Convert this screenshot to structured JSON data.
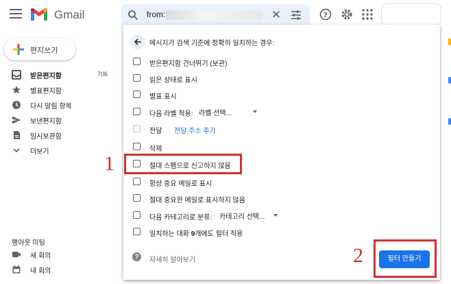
{
  "app": {
    "brand": "Gmail",
    "search": {
      "query": "from:("
    },
    "accent_color": "#1a73e8",
    "annotation_color": "#d32f2f"
  },
  "sidebar": {
    "compose_label": "편지쓰기",
    "items": [
      {
        "label": "받은편지함",
        "count": "706",
        "icon": "inbox-icon",
        "bold": true
      },
      {
        "label": "별표편지함",
        "icon": "star-icon"
      },
      {
        "label": "다시 알림 항목",
        "icon": "clock-icon"
      },
      {
        "label": "보낸편지함",
        "icon": "send-icon"
      },
      {
        "label": "임시보관함",
        "icon": "file-icon"
      },
      {
        "label": "더보기",
        "icon": "chevron-down-icon"
      }
    ],
    "meet": {
      "title": "행아웃 미팅",
      "items": [
        {
          "label": "새 회의",
          "icon": "video-icon"
        },
        {
          "label": "내 회의",
          "icon": "calendar-icon"
        }
      ]
    }
  },
  "filter_panel": {
    "header": "메시지가 검색 기준에 정확히 일치하는 경우:",
    "options": [
      {
        "label": "받은편지함 건너뛰기 (보관)"
      },
      {
        "label": "읽은 상태로 표시"
      },
      {
        "label": "별표 표시"
      },
      {
        "label": "다음 라벨 적용:",
        "select": "라벨 선택..."
      },
      {
        "label": "전달",
        "link": "전달 주소 추가",
        "disabled": true
      },
      {
        "label": "삭제"
      },
      {
        "label": "절대 스팸으로 신고하지 않음"
      },
      {
        "label": "항상 중요 메일로 표시"
      },
      {
        "label": "절대 중요한 메일로 표시하지 않음"
      },
      {
        "label": "다음 카테고리로 분류:",
        "select": "카테고리 선택..."
      },
      {
        "label_pre": "일치하는 대화 ",
        "label_count": "9",
        "label_post": "개에도 필터 적용"
      }
    ],
    "help_label": "자세히 알아보기",
    "create_button": "필터 만들기"
  },
  "annotations": [
    {
      "number": "1"
    },
    {
      "number": "2"
    }
  ]
}
